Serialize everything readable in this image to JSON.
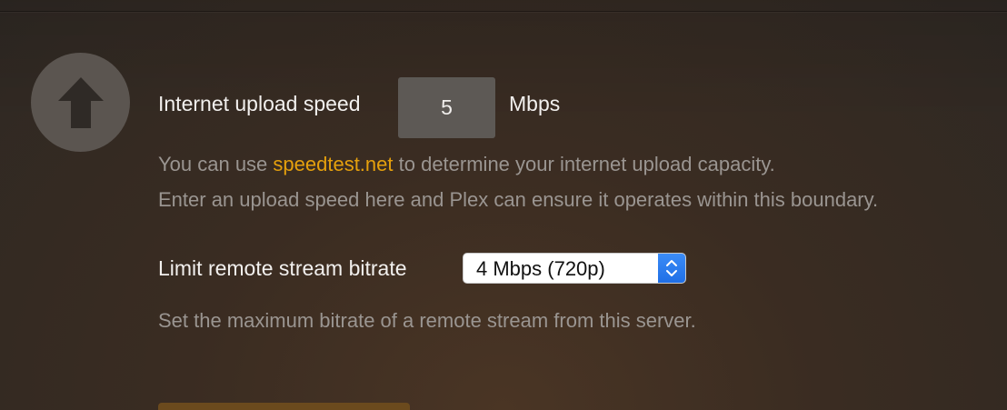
{
  "upload": {
    "label": "Internet upload speed",
    "value": "5",
    "unit": "Mbps",
    "help_prefix": "You can use ",
    "help_link": "speedtest.net",
    "help_suffix": " to determine your internet upload capacity.",
    "help_line2": "Enter an upload speed here and Plex can ensure it operates within this boundary."
  },
  "bitrate": {
    "label": "Limit remote stream bitrate",
    "selected": "4 Mbps (720p)",
    "help": "Set the maximum bitrate of a remote stream from this server."
  },
  "colors": {
    "accent": "#e5a00d",
    "select_stepper": "#2a7af0"
  },
  "icons": {
    "upload": "arrow-up-icon",
    "select": "chevron-up-down-icon"
  }
}
